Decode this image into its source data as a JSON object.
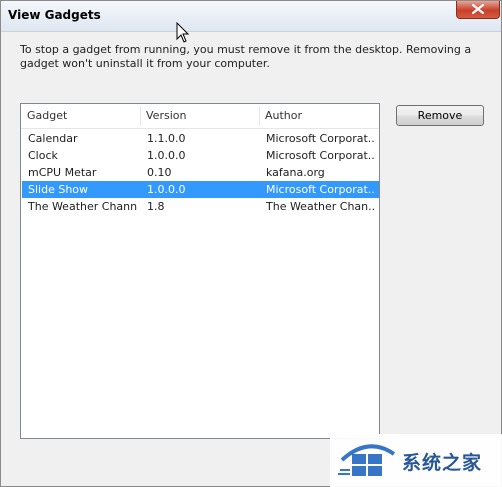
{
  "window": {
    "title": "View Gadgets"
  },
  "description": "To stop a gadget from running, you must remove it from the desktop. Removing a gadget won't uninstall it from your computer.",
  "columns": [
    "Gadget",
    "Version",
    "Author"
  ],
  "rows": [
    {
      "gadget": "Calendar",
      "version": "1.1.0.0",
      "author": "Microsoft Corporat..."
    },
    {
      "gadget": "Clock",
      "version": "1.0.0.0",
      "author": "Microsoft Corporat..."
    },
    {
      "gadget": "mCPU Metar",
      "version": "0.10",
      "author": "kafana.org"
    },
    {
      "gadget": "Slide Show",
      "version": "1.0.0.0",
      "author": "Microsoft Corporat..."
    },
    {
      "gadget": "The Weather Chann...",
      "version": "1.8",
      "author": "The Weather Chan..."
    }
  ],
  "selected_row": "Slide Show",
  "remove_label": "Remove",
  "watermark": {
    "text": "系统之家",
    "logo": "windows-logo-icon"
  },
  "colors": {
    "selection": "#3399ff",
    "close_button": "#c7402a",
    "watermark_text": "#1e4f93"
  }
}
